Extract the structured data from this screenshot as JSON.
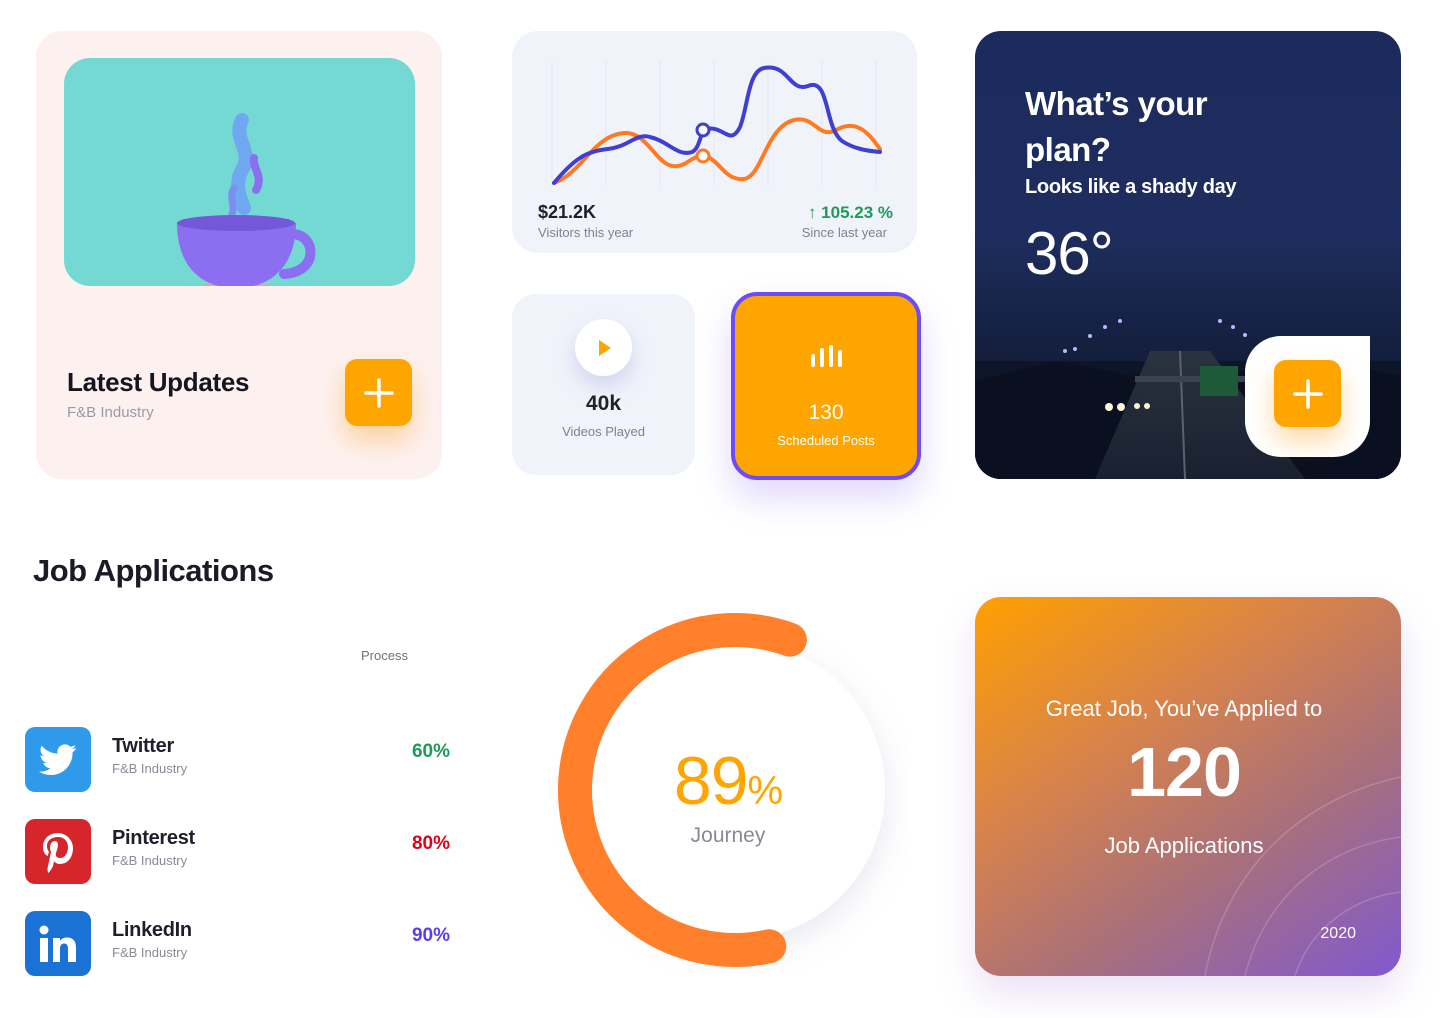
{
  "updates_card": {
    "title": "Latest Updates",
    "subtitle": "F&B Industry",
    "action_icon": "plus-icon"
  },
  "visitors_card": {
    "value": "$21.2K",
    "value_label": "Visitors this year",
    "change": "↑ 105.23 %",
    "change_label": "Since last year",
    "colors": {
      "line_a": "#3f3fd0",
      "line_b": "#ff7a20",
      "positive": "#1e9a5b"
    }
  },
  "videos_card": {
    "value": "40k",
    "label": "Videos Played",
    "icon": "play-icon"
  },
  "scheduled_card": {
    "value": "130",
    "label": "Scheduled Posts",
    "icon": "bar-chart-icon"
  },
  "weather_card": {
    "title": "What’s your plan?",
    "subtitle": "Looks like a shady day",
    "temperature": "36°",
    "action_icon": "plus-icon"
  },
  "job_applications": {
    "title": "Job Applications",
    "column_header": "Process",
    "rows": [
      {
        "name": "Twitter",
        "industry": "F&B Industry",
        "percent": "60%",
        "icon": "twitter-icon",
        "color": "#1e9a5b",
        "icon_bg": "#2f9ae9"
      },
      {
        "name": "Pinterest",
        "industry": "F&B Industry",
        "percent": "80%",
        "icon": "pinterest-icon",
        "color": "#e3001b",
        "icon_bg": "#d7262b"
      },
      {
        "name": "LinkedIn",
        "industry": "F&B Industry",
        "percent": "90%",
        "icon": "linkedin-icon",
        "color": "#5b3df2",
        "icon_bg": "#1a73d4"
      }
    ]
  },
  "journey": {
    "value": "89",
    "unit": "%",
    "label": "Journey",
    "progress_fraction": 0.59,
    "color": "#ff7f2a"
  },
  "applied_card": {
    "line1": "Great Job, You’ve Applied to",
    "count": "120",
    "line2": "Job Applications",
    "year": "2020"
  }
}
